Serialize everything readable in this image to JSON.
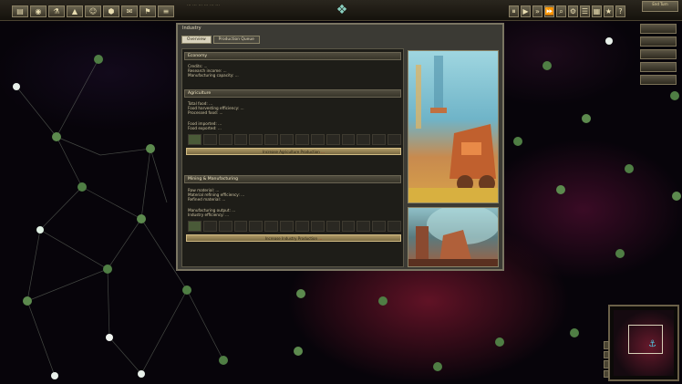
{
  "topbar": {
    "buttons": [
      {
        "icon": "menu-icon",
        "glyph": "▤"
      },
      {
        "icon": "planet-icon",
        "glyph": "◉"
      },
      {
        "icon": "research-icon",
        "glyph": "⚗"
      },
      {
        "icon": "ship-icon",
        "glyph": "▲"
      },
      {
        "icon": "people-icon",
        "glyph": "☺"
      },
      {
        "icon": "design-icon",
        "glyph": "⬢"
      },
      {
        "icon": "diplomacy-icon",
        "glyph": "✉"
      },
      {
        "icon": "empire-icon",
        "glyph": "⚑"
      },
      {
        "icon": "info-icon",
        "glyph": "≡"
      }
    ],
    "right_buttons": [
      {
        "icon": "pause-icon",
        "glyph": "⏸"
      },
      {
        "icon": "play-icon",
        "glyph": "▶"
      },
      {
        "icon": "fast-icon",
        "glyph": "»"
      },
      {
        "icon": "faster-icon",
        "glyph": "⏩"
      },
      {
        "icon": "zoom-icon",
        "glyph": "⌕"
      },
      {
        "icon": "settings-icon",
        "glyph": "⚙"
      },
      {
        "icon": "list-icon",
        "glyph": "☰"
      },
      {
        "icon": "grid-icon",
        "glyph": "▦"
      },
      {
        "icon": "star-icon",
        "glyph": "★"
      },
      {
        "icon": "help-icon",
        "glyph": "?"
      }
    ],
    "resources": "... ... ... ... ... ...",
    "corner_button": "End Turn"
  },
  "side_menu": [
    "",
    "",
    "",
    "",
    ""
  ],
  "window": {
    "title": "Industry",
    "tabs": [
      "Overview",
      "Production Queue"
    ],
    "sections": [
      {
        "header": "Economy",
        "lines": [
          "Credits: ...",
          "Research income: ...",
          "Manufacturing capacity: ..."
        ]
      },
      {
        "header": "Agriculture",
        "lines": [
          "Total food: ...",
          "Food harvesting efficiency: ...",
          "Processed food: ...",
          "Food imported: ...",
          "Food exported: ..."
        ],
        "bar": "Increase Agriculture Production",
        "bar_warn": "..."
      },
      {
        "header": "Mining & Manufacturing",
        "lines": [
          "Raw material: ...",
          "Material refining efficiency: ...",
          "Refined material: ...",
          "Manufacturing output: ...",
          "Industry efficiency: ..."
        ],
        "bar": "Increase Industry Production",
        "bar_warn": "..."
      }
    ]
  }
}
